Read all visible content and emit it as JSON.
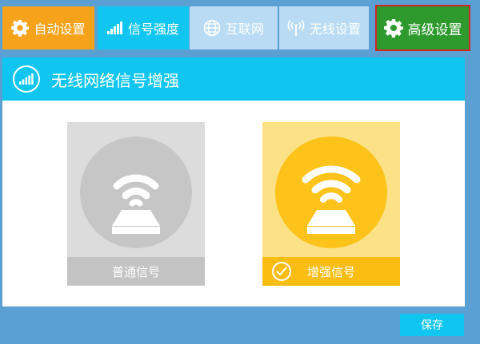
{
  "tabs": [
    {
      "label": "自动设置",
      "icon": "gear-icon"
    },
    {
      "label": "信号强度",
      "icon": "signal-bars-icon"
    },
    {
      "label": "互联网",
      "icon": "globe-icon"
    },
    {
      "label": "无线设置",
      "icon": "wireless-antenna-icon"
    },
    {
      "label": "高级设置",
      "icon": "gear-icon"
    }
  ],
  "panel": {
    "title": "无线网络信号增强",
    "icon": "signal-bars-icon"
  },
  "options": [
    {
      "label": "普通信号",
      "icon": "router-wifi-icon",
      "selected": false
    },
    {
      "label": "增强信号",
      "icon": "router-wifi-icon",
      "selected": true
    }
  ],
  "save_label": "保存",
  "colors": {
    "auto_tab": "#f7a21b",
    "active_tab": "#10c6f0",
    "inactive_tab": "#b9dbf3",
    "advanced_tab": "#2e9a2e",
    "advanced_border": "#d3252a",
    "background": "#5aa0d3",
    "normal_card": "#dcdcdc",
    "boost_card": "#fdc31a"
  }
}
